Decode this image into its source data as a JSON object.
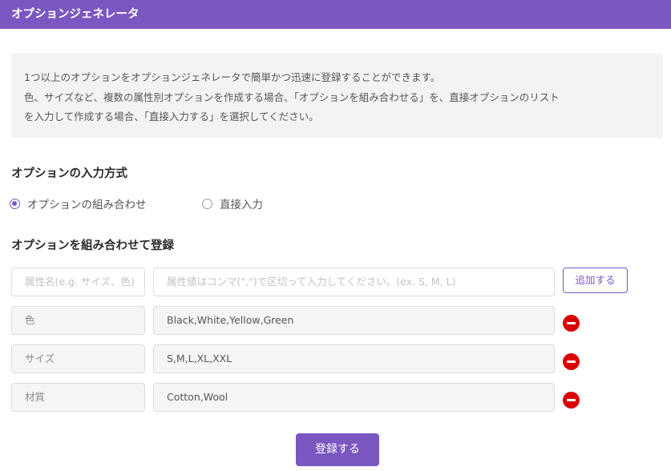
{
  "header": {
    "title": "オプションジェネレータ"
  },
  "info": {
    "lines": [
      "1つ以上のオプションをオプションジェネレータで簡単かつ迅速に登録することができます。",
      "色、サイズなど、複数の属性別オプションを作成する場合、「オプションを組み合わせる」を、直接オプションのリスト",
      "を入力して作成する場合、「直接入力する」を選択してください。"
    ]
  },
  "input_method": {
    "title": "オプションの入力方式",
    "options": [
      {
        "label": "オプションの組み合わせ",
        "checked": true
      },
      {
        "label": "直接入力",
        "checked": false
      }
    ]
  },
  "combine": {
    "title": "オプションを組み合わせて登録",
    "name_placeholder": "属性名(e.g. サイズ、色)",
    "value_placeholder": "属性値はコンマ(\",\")で区切って入力してください。(ex. S, M, L)",
    "add_label": "追加する",
    "rows": [
      {
        "name": "色",
        "values": "Black,White,Yellow,Green"
      },
      {
        "name": "サイズ",
        "values": "S,M,L,XL,XXL"
      },
      {
        "name": "材質",
        "values": "Cotton,Wool"
      }
    ]
  },
  "submit_label": "登録する",
  "colors": {
    "accent": "#7b57c2",
    "remove": "#d90000"
  }
}
